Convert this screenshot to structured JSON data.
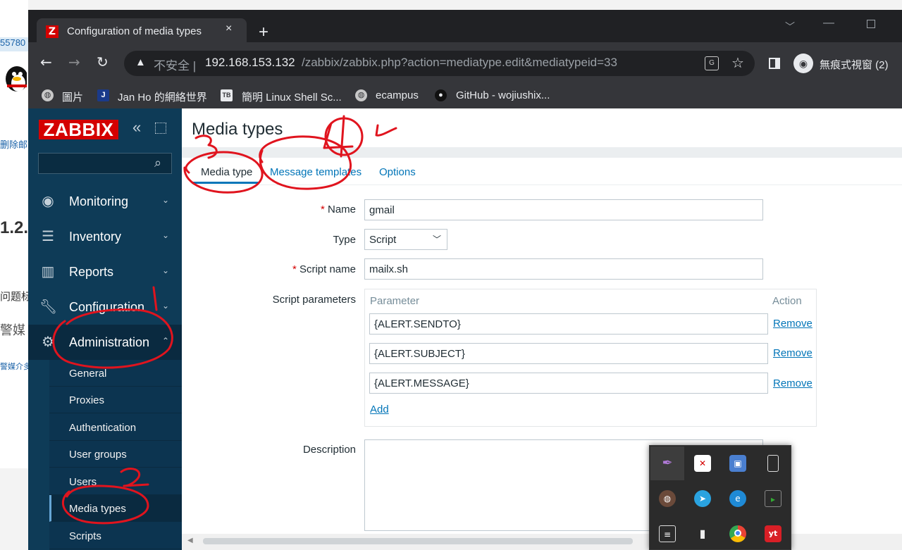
{
  "background_page": {
    "number_snippet": "55780",
    "link_text": "删除邮",
    "heading": "1.2.",
    "text_fragment": "问题标",
    "text_fragment2": "警媒",
    "link_fragment": "警媒介多"
  },
  "browser": {
    "tab_title": "Configuration of media types",
    "tab_favicon": "Z",
    "tab_close_icon": "×",
    "new_tab_icon": "+",
    "insecure_label": "不安全",
    "url_host": "192.168.153.132",
    "url_path": "/zabbix/zabbix.php?action=mediatype.edit&mediatypeid=33",
    "incognito_label": "無痕式視窗 (2)",
    "bookmarks": [
      {
        "label": "圖片",
        "icon": "globe-icon"
      },
      {
        "label": "Jan Ho 的網絡世界",
        "icon": "J"
      },
      {
        "label": "簡明 Linux Shell Sc...",
        "icon": "TB"
      },
      {
        "label": "ecampus",
        "icon": "globe-icon"
      },
      {
        "label": "GitHub - wojiushix...",
        "icon": "github-icon"
      }
    ]
  },
  "zabbix": {
    "logo": "ZABBIX",
    "menu": [
      {
        "label": "Monitoring",
        "icon": "eye-icon"
      },
      {
        "label": "Inventory",
        "icon": "list-icon"
      },
      {
        "label": "Reports",
        "icon": "bar-chart-icon"
      },
      {
        "label": "Configuration",
        "icon": "wrench-icon"
      },
      {
        "label": "Administration",
        "icon": "gear-icon"
      }
    ],
    "admin_submenu": [
      "General",
      "Proxies",
      "Authentication",
      "User groups",
      "Users",
      "Media types",
      "Scripts"
    ],
    "active_submenu": "Media types",
    "page_title": "Media types",
    "tabs": [
      "Media type",
      "Message templates",
      "Options"
    ],
    "active_tab": "Media type",
    "form": {
      "name_label": "Name",
      "name_value": "gmail",
      "type_label": "Type",
      "type_value": "Script",
      "script_name_label": "Script name",
      "script_name_value": "mailx.sh",
      "params_label": "Script parameters",
      "params_col_parameter": "Parameter",
      "params_col_action": "Action",
      "params": [
        "{ALERT.SENDTO}",
        "{ALERT.SUBJECT}",
        "{ALERT.MESSAGE}"
      ],
      "remove_label": "Remove",
      "add_label": "Add",
      "description_label": "Description",
      "required_mark": "*"
    }
  },
  "annotations": {
    "numbers": [
      "1",
      "2",
      "3",
      "4"
    ],
    "color": "#e0141e"
  },
  "colors": {
    "sidebar": "#0e3b57",
    "zabbix_red": "#d40000",
    "link_blue": "#0275b8",
    "browser_dark": "#202124"
  }
}
